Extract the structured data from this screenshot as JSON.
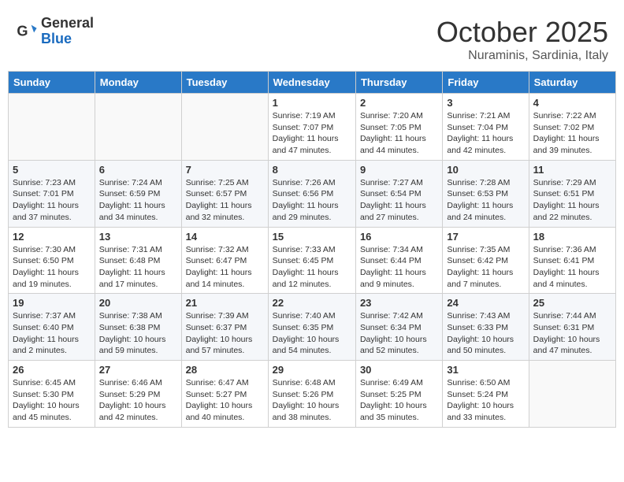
{
  "header": {
    "logo_general": "General",
    "logo_blue": "Blue",
    "month": "October 2025",
    "location": "Nuraminis, Sardinia, Italy"
  },
  "days_of_week": [
    "Sunday",
    "Monday",
    "Tuesday",
    "Wednesday",
    "Thursday",
    "Friday",
    "Saturday"
  ],
  "weeks": [
    [
      {
        "day": "",
        "info": ""
      },
      {
        "day": "",
        "info": ""
      },
      {
        "day": "",
        "info": ""
      },
      {
        "day": "1",
        "info": "Sunrise: 7:19 AM\nSunset: 7:07 PM\nDaylight: 11 hours and 47 minutes."
      },
      {
        "day": "2",
        "info": "Sunrise: 7:20 AM\nSunset: 7:05 PM\nDaylight: 11 hours and 44 minutes."
      },
      {
        "day": "3",
        "info": "Sunrise: 7:21 AM\nSunset: 7:04 PM\nDaylight: 11 hours and 42 minutes."
      },
      {
        "day": "4",
        "info": "Sunrise: 7:22 AM\nSunset: 7:02 PM\nDaylight: 11 hours and 39 minutes."
      }
    ],
    [
      {
        "day": "5",
        "info": "Sunrise: 7:23 AM\nSunset: 7:01 PM\nDaylight: 11 hours and 37 minutes."
      },
      {
        "day": "6",
        "info": "Sunrise: 7:24 AM\nSunset: 6:59 PM\nDaylight: 11 hours and 34 minutes."
      },
      {
        "day": "7",
        "info": "Sunrise: 7:25 AM\nSunset: 6:57 PM\nDaylight: 11 hours and 32 minutes."
      },
      {
        "day": "8",
        "info": "Sunrise: 7:26 AM\nSunset: 6:56 PM\nDaylight: 11 hours and 29 minutes."
      },
      {
        "day": "9",
        "info": "Sunrise: 7:27 AM\nSunset: 6:54 PM\nDaylight: 11 hours and 27 minutes."
      },
      {
        "day": "10",
        "info": "Sunrise: 7:28 AM\nSunset: 6:53 PM\nDaylight: 11 hours and 24 minutes."
      },
      {
        "day": "11",
        "info": "Sunrise: 7:29 AM\nSunset: 6:51 PM\nDaylight: 11 hours and 22 minutes."
      }
    ],
    [
      {
        "day": "12",
        "info": "Sunrise: 7:30 AM\nSunset: 6:50 PM\nDaylight: 11 hours and 19 minutes."
      },
      {
        "day": "13",
        "info": "Sunrise: 7:31 AM\nSunset: 6:48 PM\nDaylight: 11 hours and 17 minutes."
      },
      {
        "day": "14",
        "info": "Sunrise: 7:32 AM\nSunset: 6:47 PM\nDaylight: 11 hours and 14 minutes."
      },
      {
        "day": "15",
        "info": "Sunrise: 7:33 AM\nSunset: 6:45 PM\nDaylight: 11 hours and 12 minutes."
      },
      {
        "day": "16",
        "info": "Sunrise: 7:34 AM\nSunset: 6:44 PM\nDaylight: 11 hours and 9 minutes."
      },
      {
        "day": "17",
        "info": "Sunrise: 7:35 AM\nSunset: 6:42 PM\nDaylight: 11 hours and 7 minutes."
      },
      {
        "day": "18",
        "info": "Sunrise: 7:36 AM\nSunset: 6:41 PM\nDaylight: 11 hours and 4 minutes."
      }
    ],
    [
      {
        "day": "19",
        "info": "Sunrise: 7:37 AM\nSunset: 6:40 PM\nDaylight: 11 hours and 2 minutes."
      },
      {
        "day": "20",
        "info": "Sunrise: 7:38 AM\nSunset: 6:38 PM\nDaylight: 10 hours and 59 minutes."
      },
      {
        "day": "21",
        "info": "Sunrise: 7:39 AM\nSunset: 6:37 PM\nDaylight: 10 hours and 57 minutes."
      },
      {
        "day": "22",
        "info": "Sunrise: 7:40 AM\nSunset: 6:35 PM\nDaylight: 10 hours and 54 minutes."
      },
      {
        "day": "23",
        "info": "Sunrise: 7:42 AM\nSunset: 6:34 PM\nDaylight: 10 hours and 52 minutes."
      },
      {
        "day": "24",
        "info": "Sunrise: 7:43 AM\nSunset: 6:33 PM\nDaylight: 10 hours and 50 minutes."
      },
      {
        "day": "25",
        "info": "Sunrise: 7:44 AM\nSunset: 6:31 PM\nDaylight: 10 hours and 47 minutes."
      }
    ],
    [
      {
        "day": "26",
        "info": "Sunrise: 6:45 AM\nSunset: 5:30 PM\nDaylight: 10 hours and 45 minutes."
      },
      {
        "day": "27",
        "info": "Sunrise: 6:46 AM\nSunset: 5:29 PM\nDaylight: 10 hours and 42 minutes."
      },
      {
        "day": "28",
        "info": "Sunrise: 6:47 AM\nSunset: 5:27 PM\nDaylight: 10 hours and 40 minutes."
      },
      {
        "day": "29",
        "info": "Sunrise: 6:48 AM\nSunset: 5:26 PM\nDaylight: 10 hours and 38 minutes."
      },
      {
        "day": "30",
        "info": "Sunrise: 6:49 AM\nSunset: 5:25 PM\nDaylight: 10 hours and 35 minutes."
      },
      {
        "day": "31",
        "info": "Sunrise: 6:50 AM\nSunset: 5:24 PM\nDaylight: 10 hours and 33 minutes."
      },
      {
        "day": "",
        "info": ""
      }
    ]
  ]
}
